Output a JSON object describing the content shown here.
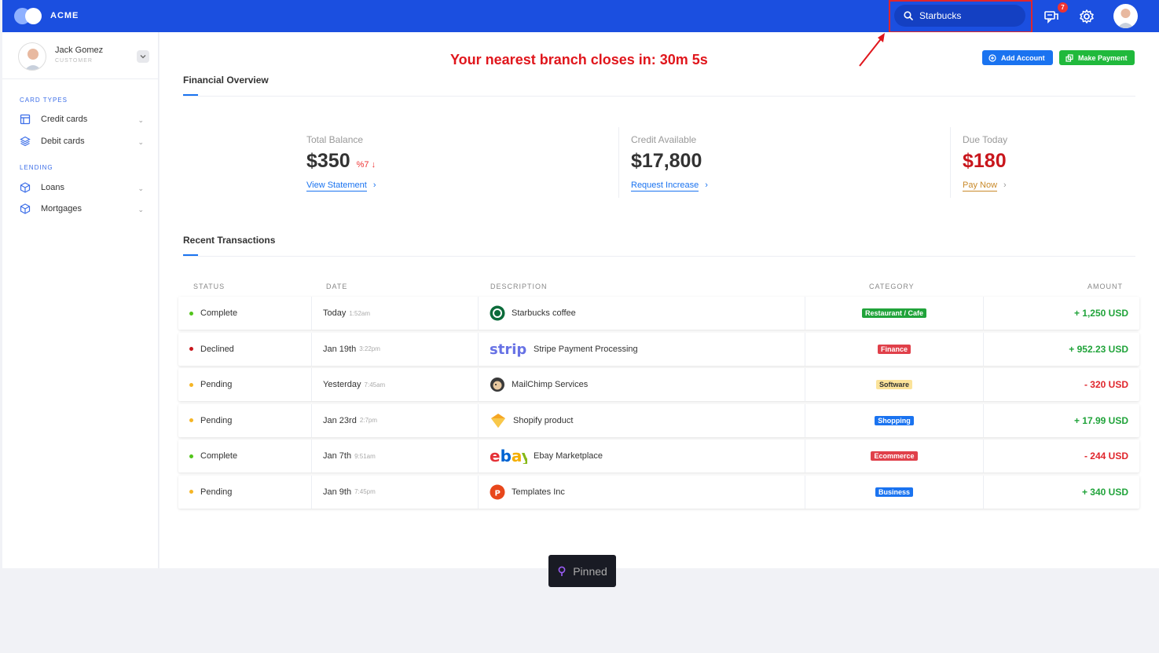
{
  "header": {
    "brand": "ACME",
    "search_value": "Starbucks",
    "notifications_count": "7",
    "icons": [
      "logo-icon",
      "search-icon",
      "chat-icon",
      "gear-icon",
      "avatar"
    ]
  },
  "user": {
    "name": "Jack Gomez",
    "role": "CUSTOMER"
  },
  "sidebar": {
    "sections": [
      {
        "heading": "CARD TYPES",
        "items": [
          {
            "label": "Credit cards",
            "icon": "layout-icon"
          },
          {
            "label": "Debit cards",
            "icon": "layers-icon"
          }
        ]
      },
      {
        "heading": "LENDING",
        "items": [
          {
            "label": "Loans",
            "icon": "box-icon"
          },
          {
            "label": "Mortgages",
            "icon": "box-icon"
          }
        ]
      }
    ]
  },
  "main": {
    "headline": "Your nearest branch closes in: 30m 5s",
    "add_account": "Add Account",
    "make_payment": "Make Payment",
    "overview_title": "Financial Overview",
    "stats": [
      {
        "label": "Total Balance",
        "value": "$350",
        "change": "%7",
        "change_arrow": "↓",
        "link": "View Statement",
        "color": "#333333"
      },
      {
        "label": "Credit Available",
        "value": "$17,800",
        "link": "Request Increase",
        "color": "#333333"
      },
      {
        "label": "Due Today",
        "value": "$180",
        "link": "Pay Now",
        "color": "#c8161c"
      }
    ],
    "transactions_title": "Recent Transactions",
    "columns": [
      "STATUS",
      "DATE",
      "DESCRIPTION",
      "CATEGORY",
      "AMOUNT"
    ],
    "rows": [
      {
        "status": "Complete",
        "status_color": "#52c41a",
        "date": "Today",
        "time": "1:52am",
        "desc": "Starbucks coffee",
        "logo": "starbucks-icon",
        "category": "Restaurant / Cafe",
        "cat_color": "#20a33a",
        "cat_text": "#ffffff",
        "amount": "+ 1,250 USD",
        "amount_color": "#20a33a"
      },
      {
        "status": "Declined",
        "status_color": "#c8161c",
        "date": "Jan 19th",
        "time": "3:22pm",
        "desc": "Stripe Payment Processing",
        "logo": "stripe-icon",
        "category": "Finance",
        "cat_color": "#e0404a",
        "cat_text": "#ffffff",
        "amount": "+ 952.23 USD",
        "amount_color": "#20a33a"
      },
      {
        "status": "Pending",
        "status_color": "#f5b525",
        "date": "Yesterday",
        "time": "7:45am",
        "desc": "MailChimp Services",
        "logo": "mailchimp-icon",
        "category": "Software",
        "cat_color": "#fbe39a",
        "cat_text": "#333333",
        "amount": "- 320 USD",
        "amount_color": "#e0262c"
      },
      {
        "status": "Pending",
        "status_color": "#f5b525",
        "date": "Jan 23rd",
        "time": "2:7pm",
        "desc": "Shopify product",
        "logo": "shopify-icon",
        "category": "Shopping",
        "cat_color": "#1a73f0",
        "cat_text": "#ffffff",
        "amount": "+ 17.99 USD",
        "amount_color": "#20a33a"
      },
      {
        "status": "Complete",
        "status_color": "#52c41a",
        "date": "Jan 7th",
        "time": "9:51am",
        "desc": "Ebay Marketplace",
        "logo": "ebay-icon",
        "category": "Ecommerce",
        "cat_color": "#e0404a",
        "cat_text": "#ffffff",
        "amount": "- 244 USD",
        "amount_color": "#e0262c"
      },
      {
        "status": "Pending",
        "status_color": "#f5b525",
        "date": "Jan 9th",
        "time": "7:45pm",
        "desc": "Templates Inc",
        "logo": "templates-icon",
        "category": "Business",
        "cat_color": "#1a73f0",
        "cat_text": "#ffffff",
        "amount": "+ 340 USD",
        "amount_color": "#20a33a"
      }
    ]
  },
  "pinned_label": "Pinned"
}
